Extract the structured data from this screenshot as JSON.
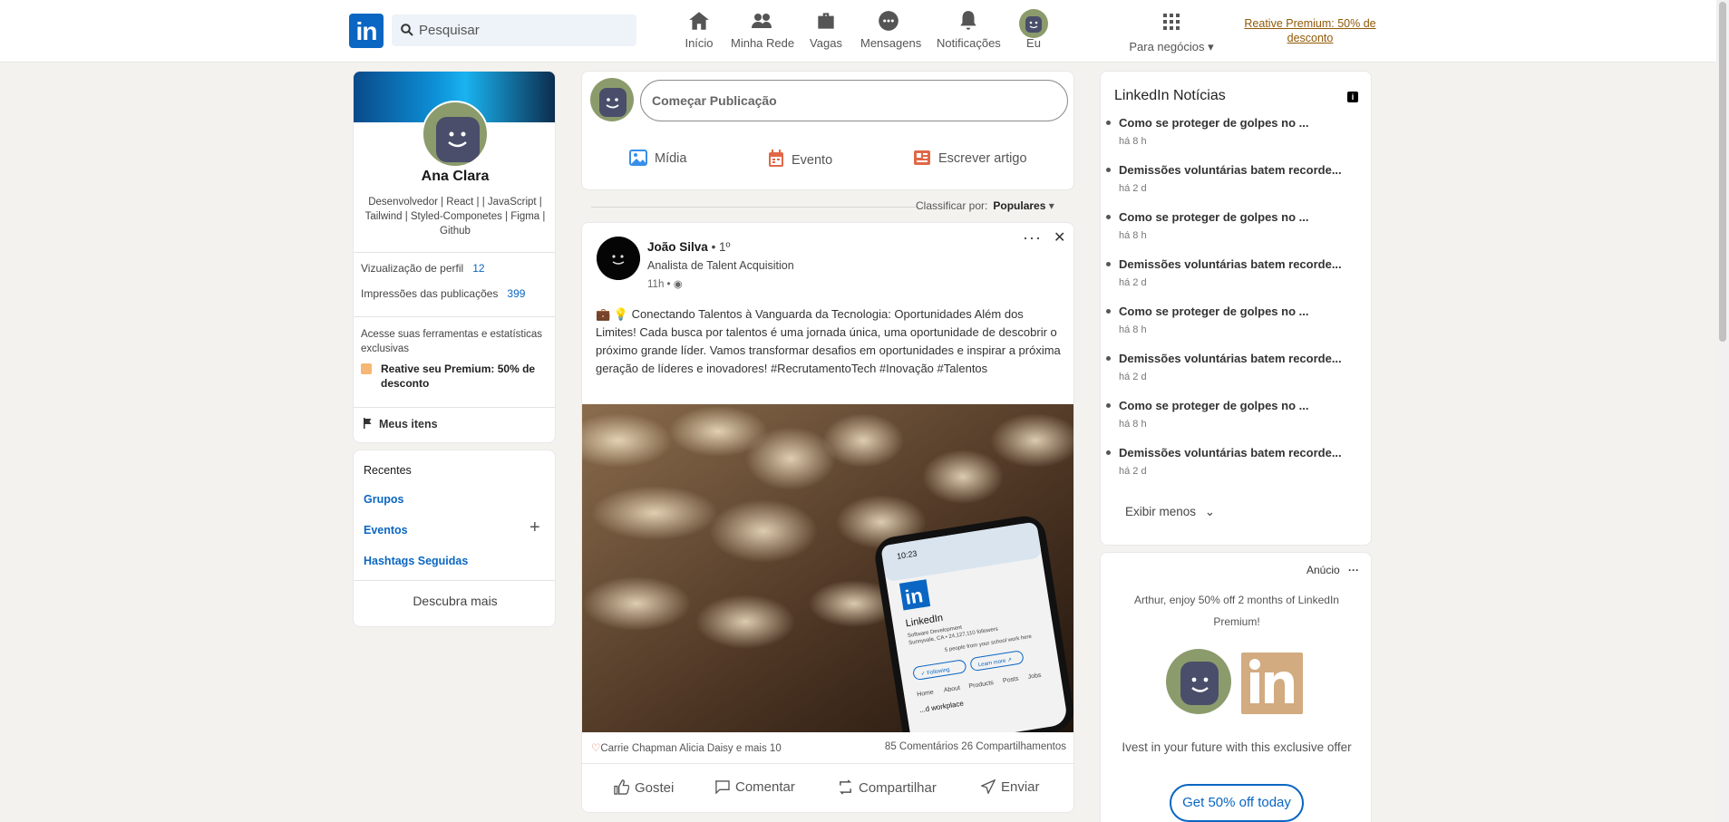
{
  "nav": {
    "search_placeholder": "Pesquisar",
    "items": [
      {
        "label": "Início",
        "icon": "home-icon"
      },
      {
        "label": "Minha Rede",
        "icon": "network-icon"
      },
      {
        "label": "Vagas",
        "icon": "briefcase-icon"
      },
      {
        "label": "Mensagens",
        "icon": "messaging-icon"
      },
      {
        "label": "Notificações",
        "icon": "bell-icon"
      },
      {
        "label": "Eu",
        "icon": "avatar"
      }
    ],
    "business_label": "Para negócios",
    "premium_link": "Reative Premium: 50% de desconto"
  },
  "profile": {
    "name": "Ana Clara",
    "description": "Desenvolvedor | React | | JavaScript | Tailwind | Styled-Componetes | Figma | Github",
    "stats": [
      {
        "label": "Vizualização de perfil",
        "value": "12"
      },
      {
        "label": "Impressões das publicações",
        "value": "399"
      }
    ],
    "tools_text": "Acesse suas ferramentas e estatísticas exclusivas",
    "premium_text": "Reative seu Premium: 50% de desconto",
    "my_items": "Meus itens"
  },
  "recent": {
    "title": "Recentes",
    "links": [
      "Grupos",
      "Eventos",
      "Hashtags Seguidas"
    ],
    "discover": "Descubra mais"
  },
  "compose": {
    "placeholder": "Começar Publicação",
    "actions": [
      "Mídia",
      "Evento",
      "Escrever artigo"
    ]
  },
  "sort": {
    "label": "Classificar por:",
    "value": "Populares"
  },
  "post": {
    "author": "João Silva",
    "degree": "• 1º",
    "headline": "Analista de Talent Acquisition",
    "time": "11h •",
    "text": "💼 💡 Conectando Talentos à Vanguarda da Tecnologia: Oportunidades Além dos Limites! Cada busca por talentos é uma jornada única, uma oportunidade de descobrir o próximo grande líder. Vamos transformar desafios em oportunidades e inspirar a próxima geração de líderes e inovadores! #RecrutamentoTech #Inovação #Talentos",
    "phone_time": "10:23",
    "phone_company": "LinkedIn",
    "phone_subtitle": "Software Development",
    "phone_location": "Sunnyvale, CA • 24,127,110 followers",
    "phone_connections": "5 people from your school work here",
    "phone_following": "✓ Following",
    "phone_learn_more": "Learn more ↗",
    "phone_tabs": [
      "Home",
      "About",
      "Products",
      "Posts",
      "Jobs"
    ],
    "phone_bottom": "...d workplace",
    "reactions": "Carrie Chapman Alicia Daisy e mais 10",
    "counts": "85 Comentários 26 Compartilhamentos",
    "actions": [
      "Gostei",
      "Comentar",
      "Compartilhar",
      "Enviar"
    ]
  },
  "news": {
    "title": "LinkedIn Notícias",
    "items": [
      {
        "headline": "Como se proteger de golpes no ...",
        "age": "há 8 h"
      },
      {
        "headline": "Demissões voluntárias batem recorde...",
        "age": "há 2 d"
      },
      {
        "headline": "Como se proteger de golpes no ...",
        "age": "há 8 h"
      },
      {
        "headline": "Demissões voluntárias batem recorde...",
        "age": "há 2 d"
      },
      {
        "headline": "Como se proteger de golpes no ...",
        "age": "há 8 h"
      },
      {
        "headline": "Demissões voluntárias batem recorde...",
        "age": "há 2 d"
      },
      {
        "headline": "Como se proteger de golpes no ...",
        "age": "há 8 h"
      },
      {
        "headline": "Demissões voluntárias batem recorde...",
        "age": "há 2 d"
      }
    ],
    "show_less": "Exibir menos"
  },
  "ad": {
    "label": "Anúcio",
    "text": "Arthur, enjoy 50% off 2 months of LinkedIn Premium!",
    "cta_text": "Ivest in your future with this exclusive offer",
    "button": "Get 50% off today"
  },
  "colors": {
    "brand": "#0a66c2",
    "premium": "#915907",
    "background": "#f4f2ee"
  }
}
